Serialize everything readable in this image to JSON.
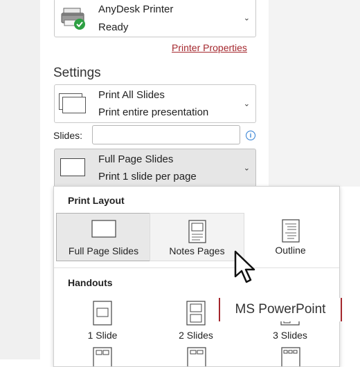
{
  "printer": {
    "name": "AnyDesk Printer",
    "status": "Ready",
    "properties_link": "Printer Properties",
    "status_color": "#2ea043"
  },
  "settings": {
    "heading": "Settings",
    "print_range": {
      "title": "Print All Slides",
      "subtitle": "Print entire presentation"
    },
    "slides_label": "Slides:",
    "slides_value": "",
    "layout": {
      "title": "Full Page Slides",
      "subtitle": "Print 1 slide per page"
    }
  },
  "layout_panel": {
    "print_layout_heading": "Print Layout",
    "options": [
      {
        "label": "Full Page Slides",
        "icon": "full-page-slide-icon",
        "state": "selected"
      },
      {
        "label": "Notes Pages",
        "icon": "notes-page-icon",
        "state": "hover"
      },
      {
        "label": "Outline",
        "icon": "outline-icon",
        "state": "normal"
      }
    ],
    "handouts_heading": "Handouts",
    "handouts": [
      {
        "label": "1 Slide",
        "icon": "handout-1-slide-icon"
      },
      {
        "label": "2 Slides",
        "icon": "handout-2-slides-icon"
      },
      {
        "label": "3 Slides",
        "icon": "handout-3-slides-icon"
      }
    ]
  },
  "overlay": {
    "brand_text": "MS PowerPoint",
    "accent_color": "#a4262c"
  }
}
